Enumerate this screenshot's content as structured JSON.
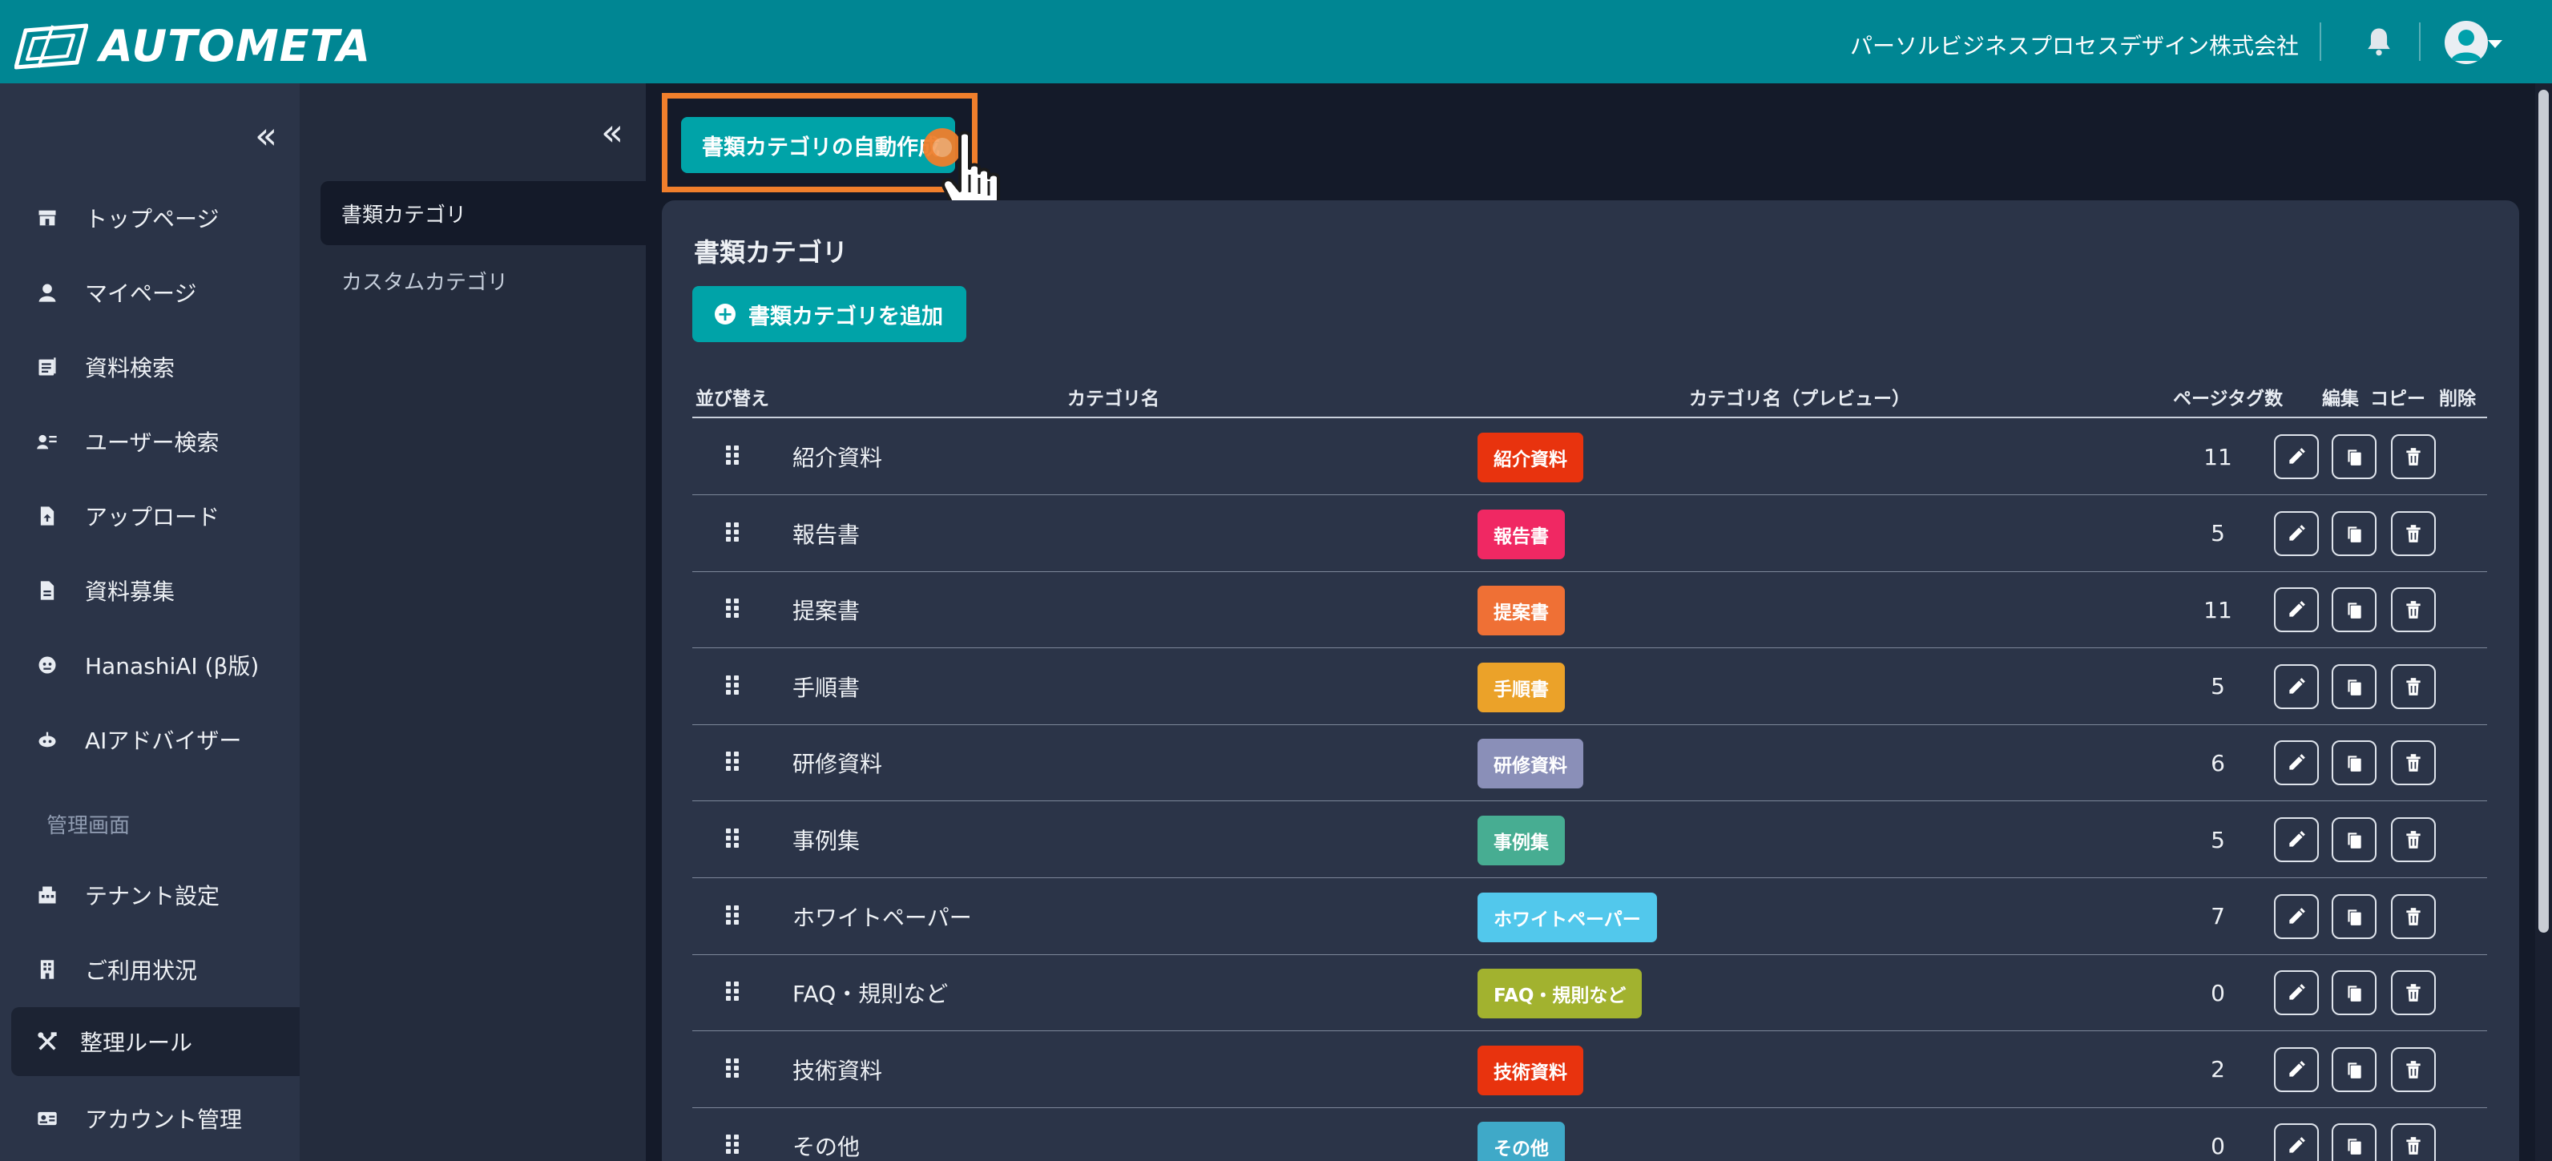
{
  "header": {
    "logo_text": "AUTOMETA",
    "company_name": "パーソルビジネスプロセスデザイン株式会社",
    "bell_icon": "bell-icon",
    "avatar_icon": "user-avatar-icon",
    "bar_color": "#008693"
  },
  "sidebar": {
    "collapse_icon": "«",
    "items": [
      {
        "label": "トップページ",
        "icon": "store-icon"
      },
      {
        "label": "マイページ",
        "icon": "person-icon"
      },
      {
        "label": "資料検索",
        "icon": "document-search-icon"
      },
      {
        "label": "ユーザー検索",
        "icon": "user-search-icon"
      },
      {
        "label": "アップロード",
        "icon": "file-upload-icon"
      },
      {
        "label": "資料募集",
        "icon": "file-icon"
      },
      {
        "label": "HanashiAI (β版)",
        "icon": "chat-bot-icon"
      },
      {
        "label": "AIアドバイザー",
        "icon": "robot-icon"
      }
    ],
    "section_label": "管理画面",
    "admin_items": [
      {
        "label": "テナント設定",
        "icon": "building-settings-icon"
      },
      {
        "label": "ご利用状況",
        "icon": "building-icon"
      },
      {
        "label": "整理ルール",
        "icon": "tools-icon",
        "active": true
      },
      {
        "label": "アカウント管理",
        "icon": "id-card-icon"
      }
    ]
  },
  "subnav": {
    "collapse_icon": "«",
    "items": [
      {
        "label": "書類カテゴリ",
        "active": true
      },
      {
        "label": "カスタムカテゴリ",
        "active": false
      }
    ]
  },
  "main": {
    "auto_create_button": "書類カテゴリの自動作成",
    "card_title": "書類カテゴリ",
    "add_button": "書類カテゴリを追加",
    "accent_color": "#00a3a8",
    "highlight_color": "#f07f2c",
    "columns": {
      "sort": "並び替え",
      "name": "カテゴリ名",
      "preview": "カテゴリ名（プレビュー）",
      "page_tags": "ページタグ数",
      "edit": "編集",
      "copy": "コピー",
      "delete": "削除"
    },
    "rows": [
      {
        "name": "紹介資料",
        "badge": "紹介資料",
        "color": "#e8330e",
        "count": "11"
      },
      {
        "name": "報告書",
        "badge": "報告書",
        "color": "#f02863",
        "count": "5"
      },
      {
        "name": "提案書",
        "badge": "提案書",
        "color": "#ef7035",
        "count": "11"
      },
      {
        "name": "手順書",
        "badge": "手順書",
        "color": "#eba229",
        "count": "5"
      },
      {
        "name": "研修資料",
        "badge": "研修資料",
        "color": "#8a8fb8",
        "count": "6"
      },
      {
        "name": "事例集",
        "badge": "事例集",
        "color": "#47ad92",
        "count": "5"
      },
      {
        "name": "ホワイトペーパー",
        "badge": "ホワイトペーパー",
        "color": "#52c8ec",
        "count": "7"
      },
      {
        "name": "FAQ・規則など",
        "badge": "FAQ・規則など",
        "color": "#a2b22f",
        "count": "0"
      },
      {
        "name": "技術資料",
        "badge": "技術資料",
        "color": "#e8330e",
        "count": "2"
      },
      {
        "name": "その他",
        "badge": "その他",
        "color": "#3fa9c8",
        "count": "0"
      }
    ]
  }
}
